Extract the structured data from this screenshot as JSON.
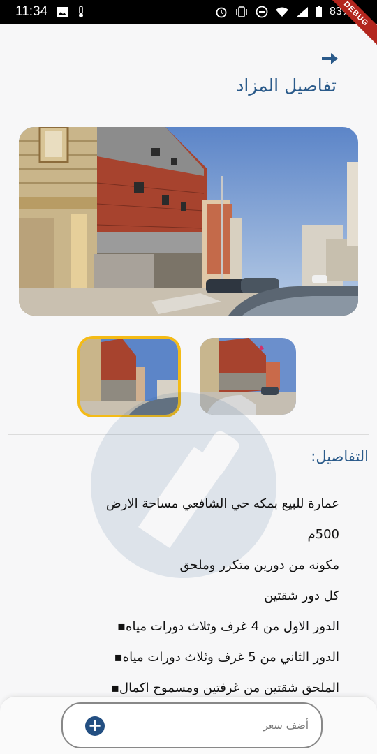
{
  "status_bar": {
    "time": "11:34",
    "battery": "83%",
    "debug_label": "DEBUG"
  },
  "header": {
    "title": "تفاصيل المزاد",
    "back_icon": "arrow-right-icon"
  },
  "details": {
    "heading": "التفاصيل:",
    "lines": [
      "عمارة للبيع بمكه حي الشافعي مساحة الارض",
      "500م",
      "مكونه من دورين متكرر وملحق",
      "كل دور شقتين",
      "الدور الاول من 4 غرف وثلاث دورات مياه▪",
      "الدور الثاني من 5 غرف وثلاث دورات مياه▪",
      "الملحق شقتين من غرفتين ومسموح اكمال▪"
    ]
  },
  "bid_input": {
    "placeholder": "أضف سعر",
    "add_icon": "plus-circle-icon"
  },
  "colors": {
    "accent": "#2a5a8a",
    "selected_border": "#f4bb16",
    "button": "#234f82"
  }
}
